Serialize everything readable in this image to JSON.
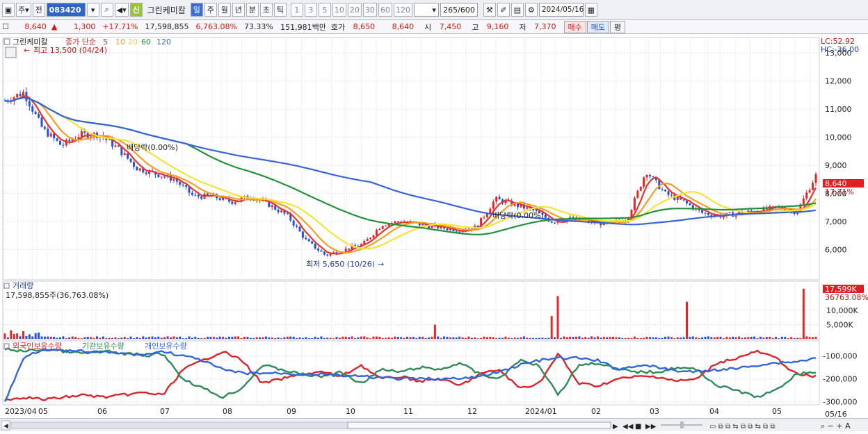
{
  "toolbar": {
    "period_select": "주",
    "prev_label": "전",
    "stock_code": "083420",
    "new_badge": "신",
    "stock_name": "그린케미칼",
    "periods": [
      "일",
      "주",
      "월",
      "년",
      "분",
      "초",
      "틱"
    ],
    "active_period": "일",
    "intervals": [
      "1",
      "3",
      "5",
      "10",
      "20",
      "30",
      "60",
      "120"
    ],
    "count_value": "265",
    "count_total": "/600",
    "date_value": "2024/05/16"
  },
  "quote": {
    "price": "8,640",
    "change": "1,300",
    "change_pct": "+17.71%",
    "volume": "17,598,855",
    "volume_ratio": "6,763.08%",
    "turnover": "73.33%",
    "amount": "151,981백만",
    "bid_ask_label": "호가",
    "bid": "8,650",
    "ask": "8,640",
    "open_label": "시",
    "open": "7,450",
    "high_label": "고",
    "high": "9,160",
    "low_label": "저",
    "low": "7,370",
    "buy_label": "매수",
    "sell_label": "매도",
    "eval_label": "평"
  },
  "price_panel": {
    "title": "그린케미칼",
    "ma_label": "종가 단순",
    "ma_periods": [
      "5",
      "10",
      "20",
      "60",
      "120"
    ],
    "high_annotation": "최고 13,500 (04/24)",
    "low_annotation": "최저 5,650 (10/26)",
    "dividend_1": "배당락(0.00%)",
    "dividend_2": "배당락(0.00%)",
    "lc": "LC:52.92",
    "hc": "HC:-36.00",
    "last_price": "8,640",
    "last_pct": "17.71%"
  },
  "volume_panel": {
    "title": "거래량",
    "info": "17,598,855주(36,763.08%)",
    "last_value": "17,599K",
    "last_pct": "36763.08%"
  },
  "holdings_panel": {
    "series": [
      "외국인보유수량",
      "기관보유수량",
      "개인보유수량"
    ]
  },
  "chart_data": [
    {
      "type": "line",
      "title": "그린케미칼",
      "x": [
        "2023/04",
        "05",
        "06",
        "07",
        "08",
        "09",
        "10",
        "11",
        "12",
        "2024/01",
        "02",
        "03",
        "04",
        "05"
      ],
      "ylim": [
        5000,
        13500
      ],
      "yticks": [
        "6,000",
        "7,000",
        "8,000",
        "9,000",
        "10,000",
        "11,000",
        "12,000",
        "13,000"
      ],
      "close": [
        11300,
        11600,
        10300,
        9700,
        10100,
        10100,
        9600,
        8900,
        8700,
        8500,
        7900,
        7900,
        7700,
        7900,
        7600,
        7200,
        6300,
        5800,
        6000,
        6200,
        6900,
        7000,
        6900,
        6800,
        6700,
        6800,
        7800,
        7600,
        7400,
        7000,
        7100,
        7000,
        6900,
        7100,
        8800,
        8000,
        7700,
        7300,
        7200,
        7300,
        7400,
        7500,
        7340,
        8640
      ],
      "series": [
        {
          "name": "5",
          "color": "#e8322d"
        },
        {
          "name": "10",
          "color": "#f0a023"
        },
        {
          "name": "20",
          "color": "#f4e43a"
        },
        {
          "name": "60",
          "color": "#23903a"
        },
        {
          "name": "120",
          "color": "#3964d8"
        }
      ],
      "grid": true
    },
    {
      "type": "bar",
      "title": "거래량",
      "yticks": [
        "5,000K",
        "10,000K"
      ],
      "spikes": [
        {
          "x": "11",
          "value": 5000
        },
        {
          "x": "2024/01",
          "value": 8000
        },
        {
          "x": "2024/01",
          "value": 15000
        },
        {
          "x": "03",
          "value": 13000
        },
        {
          "x": "05",
          "value": 17599
        }
      ]
    },
    {
      "type": "line",
      "title": "보유수량",
      "yticks": [
        "-100,000",
        "-200,000",
        "-300,000"
      ],
      "series": [
        {
          "name": "외국인보유수량",
          "color": "#d8242a"
        },
        {
          "name": "기관보유수량",
          "color": "#2f8a5a"
        },
        {
          "name": "개인보유수량",
          "color": "#3466d8"
        }
      ]
    }
  ],
  "bottom": {
    "axis_end": "05/16"
  }
}
